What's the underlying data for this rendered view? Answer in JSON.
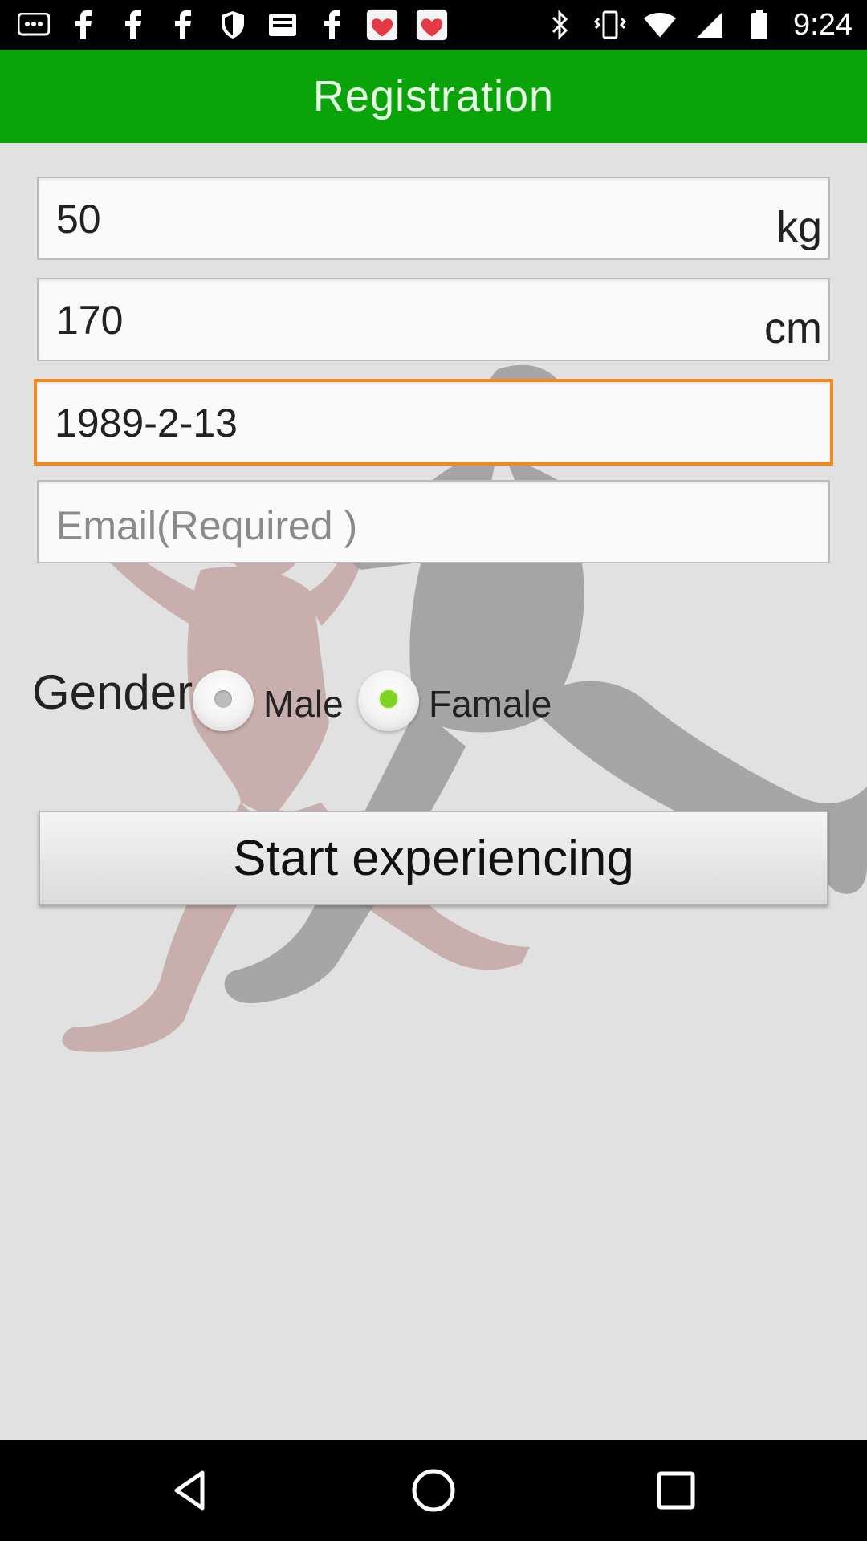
{
  "status_bar": {
    "time": "9:24",
    "left_icons": [
      "message-dots-icon",
      "fb-icon",
      "fb-icon",
      "fb-icon",
      "shield-icon",
      "inbox-icon",
      "fb-icon",
      "fast-meet-app-icon",
      "fast-meet-app-icon"
    ],
    "right_icons": [
      "bluetooth-icon",
      "vibrate-icon",
      "wifi-icon",
      "cellular-signal-icon",
      "battery-icon"
    ]
  },
  "header": {
    "title": "Registration",
    "color": "#0aa40a"
  },
  "form": {
    "weight": {
      "value": "50",
      "unit": "kg"
    },
    "height": {
      "value": "170",
      "unit": "cm"
    },
    "birthdate": {
      "value": "1989-2-13",
      "focused": true,
      "focus_color": "#f08a1e"
    },
    "email": {
      "value": "",
      "placeholder": "Email(Required )"
    },
    "gender": {
      "label": "Gender",
      "options": [
        {
          "label": "Male",
          "selected": false
        },
        {
          "label": "Famale",
          "selected": true
        }
      ],
      "selected_color": "#7ed321"
    },
    "submit_label": "Start experiencing"
  },
  "nav_bar": {
    "buttons": [
      "back-icon",
      "home-icon",
      "recents-icon"
    ]
  }
}
